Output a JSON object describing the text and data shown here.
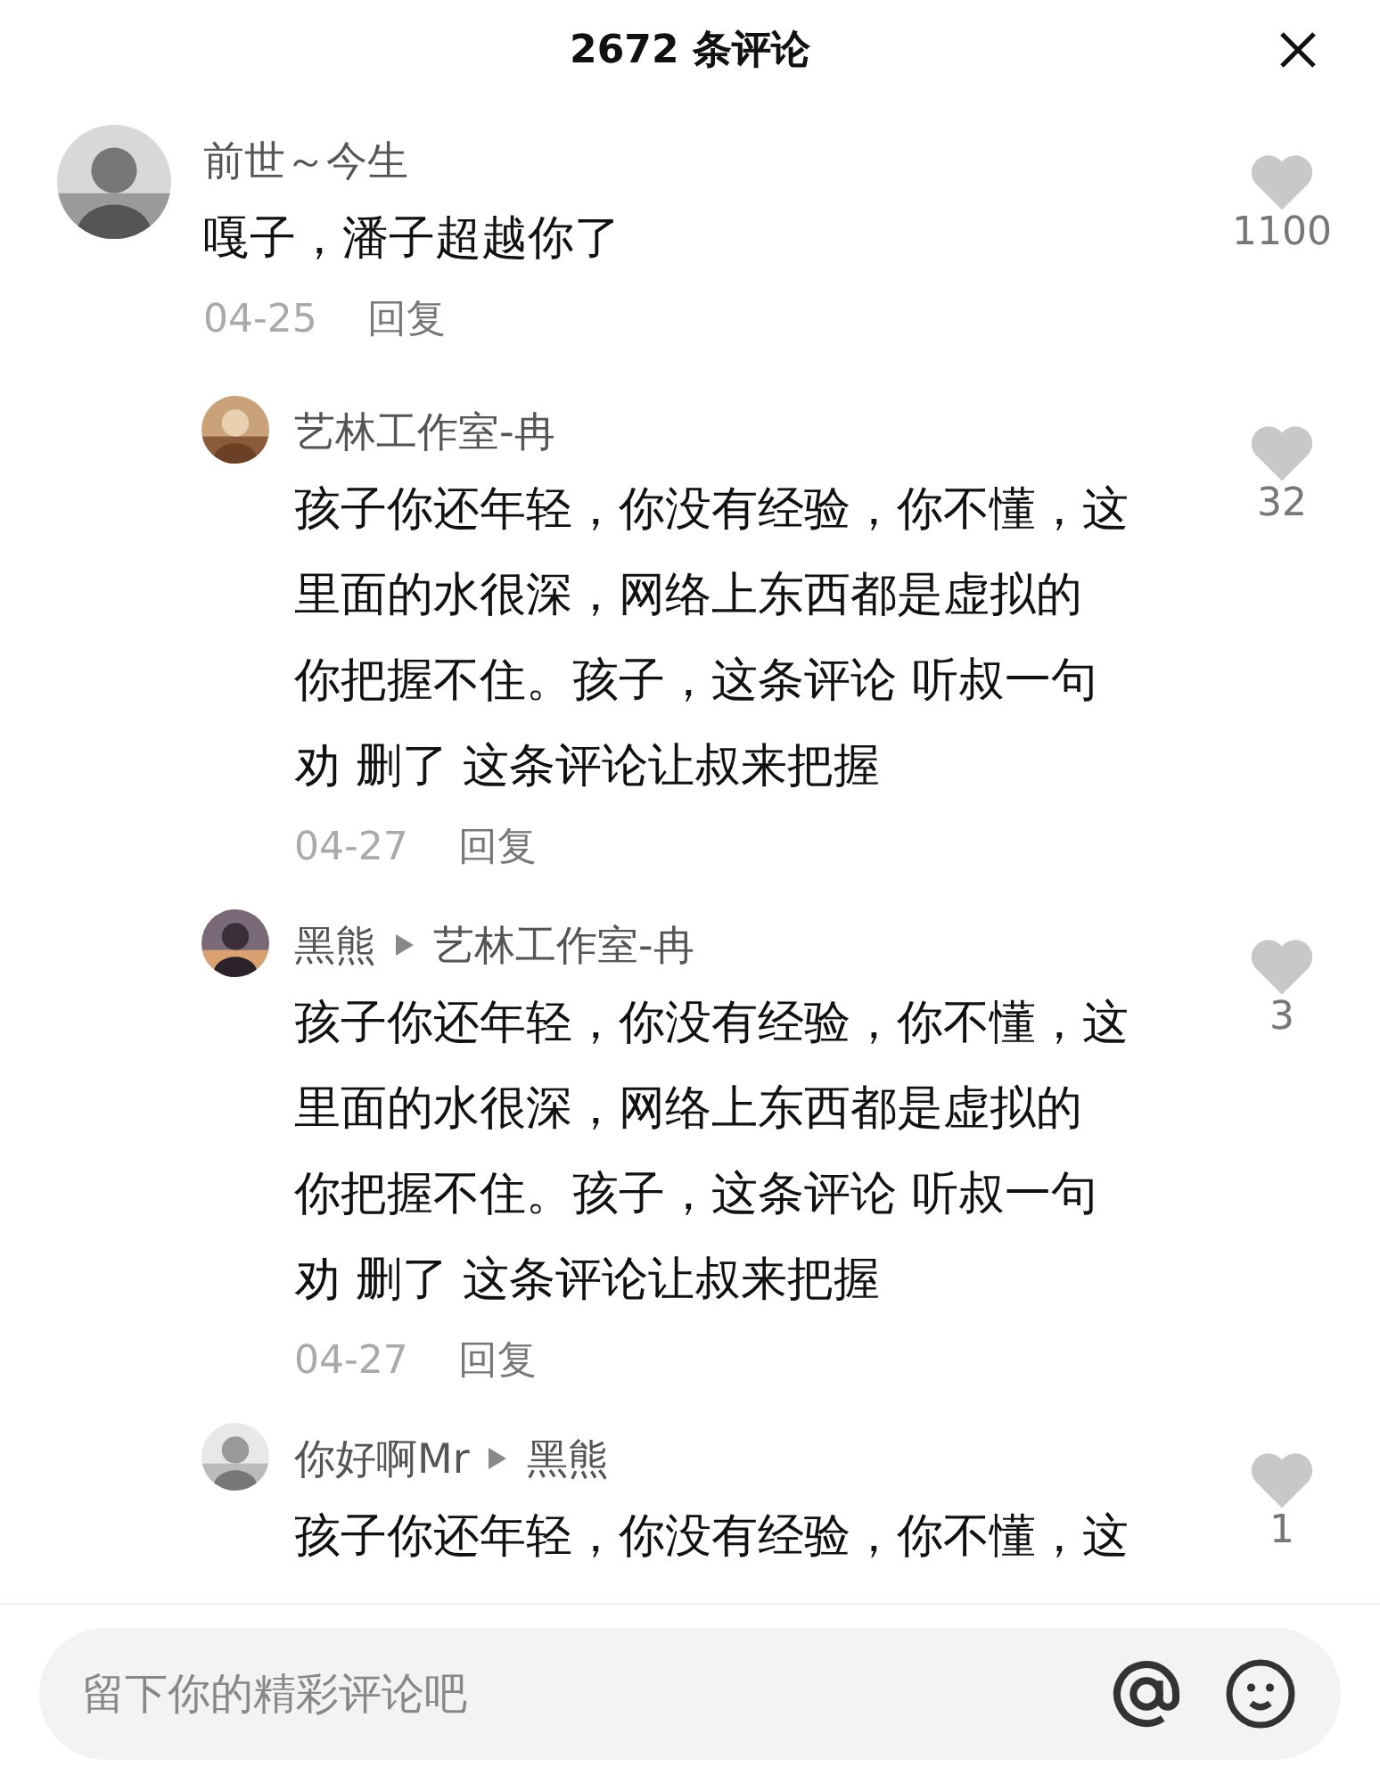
{
  "header": {
    "title": "2672 条评论"
  },
  "comments": [
    {
      "author": "前世～今生",
      "date": "04-25",
      "reply_label": "回复",
      "lines": [
        "嘎子，潘子超越你了"
      ],
      "likes": "1100",
      "replies": [
        {
          "author": "艺林工作室-冉",
          "lines": [
            "孩子你还年轻，你没有经验，你不懂，这",
            "里面的水很深，网络上东西都是虚拟的",
            "你把握不住。孩子，这条评论 听叔一句",
            "劝 删了 这条评论让叔来把握"
          ],
          "date": "04-27",
          "reply_label": "回复",
          "likes": "32"
        },
        {
          "author": "黑熊",
          "reply_to": "艺林工作室-冉",
          "lines": [
            "孩子你还年轻，你没有经验，你不懂，这",
            "里面的水很深，网络上东西都是虚拟的",
            "你把握不住。孩子，这条评论 听叔一句",
            "劝 删了 这条评论让叔来把握"
          ],
          "date": "04-27",
          "reply_label": "回复",
          "likes": "3"
        },
        {
          "author": "你好啊Mr",
          "reply_to": "黑熊",
          "lines": [
            "孩子你还年轻，你没有经验，你不懂，这"
          ],
          "likes": "1"
        }
      ]
    }
  ],
  "composer": {
    "placeholder": "留下你的精彩评论吧"
  }
}
